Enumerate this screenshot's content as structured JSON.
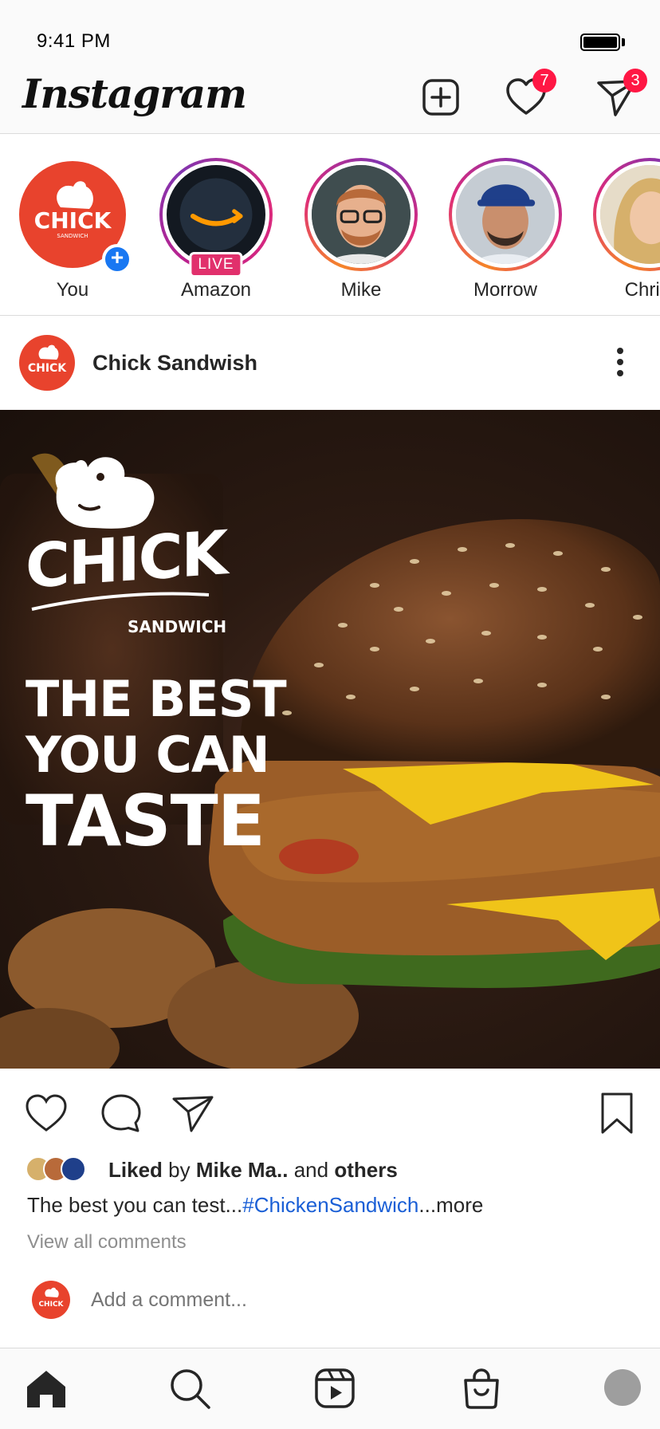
{
  "status_bar": {
    "time": "9:41 PM"
  },
  "header": {
    "logo": "Instagram",
    "notifications_count": "7",
    "messages_count": "3"
  },
  "stories": [
    {
      "label": "You",
      "badge": "+"
    },
    {
      "label": "Amazon",
      "badge": "LIVE"
    },
    {
      "label": "Mike"
    },
    {
      "label": "Morrow"
    },
    {
      "label": "Christ"
    }
  ],
  "brand": {
    "logo_main": "CHICK",
    "logo_sub": "SANDWICH"
  },
  "post": {
    "username": "Chick Sandwish",
    "image_text": {
      "brand_main": "CHICK",
      "brand_sub": "SANDWICH",
      "line1": "THE BEST",
      "line2": "YOU CAN",
      "line3": "TASTE"
    },
    "likes": {
      "liked": "Liked",
      "by": "by",
      "user": "Mike Ma..",
      "and": "and",
      "others": "others"
    },
    "caption": {
      "text": "The best you can test...",
      "hashtag": "#ChickenSandwich",
      "more": "...more"
    },
    "view_comments": "View all comments",
    "comment_placeholder": "Add a comment..."
  },
  "colors": {
    "brand_red": "#e8432d",
    "badge_red": "#ff1744",
    "link_blue": "#1a5fd6",
    "live_pink": "#e1306c"
  }
}
